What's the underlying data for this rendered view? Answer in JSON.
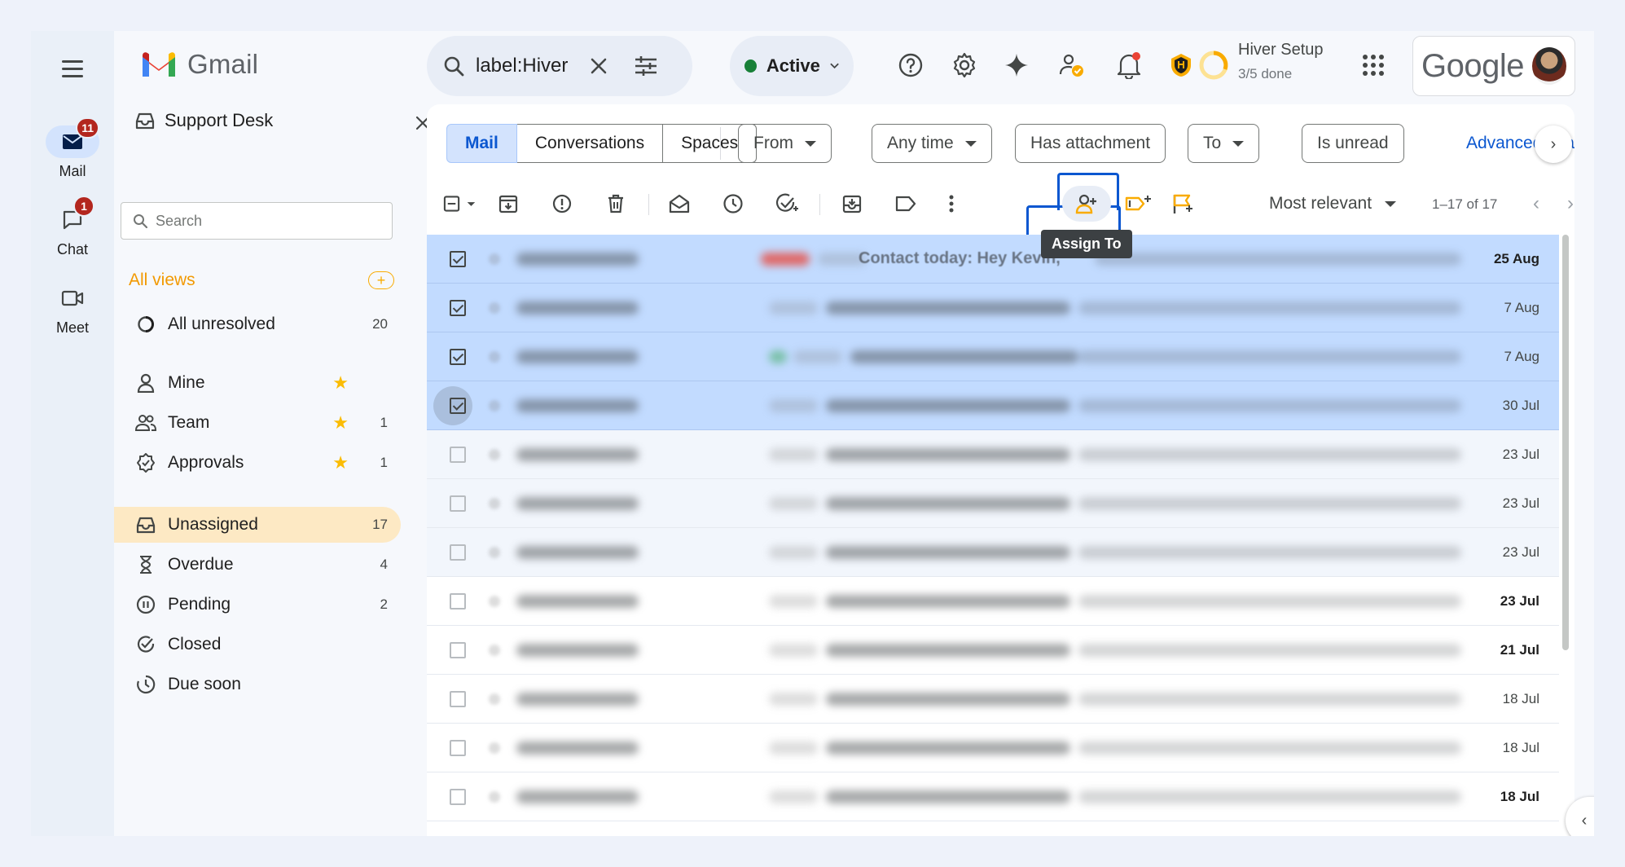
{
  "app": {
    "logo_text": "Gmail"
  },
  "rail": {
    "items": [
      {
        "label": "Mail",
        "badge": "11",
        "icon": "mail-icon"
      },
      {
        "label": "Chat",
        "badge": "1",
        "icon": "chat-icon"
      },
      {
        "label": "Meet",
        "icon": "video-icon"
      }
    ]
  },
  "search": {
    "query": "label:Hiver"
  },
  "status": {
    "label": "Active",
    "color": "#188038"
  },
  "setup": {
    "title": "Hiver Setup",
    "progress": "3/5 done"
  },
  "account": {
    "brand": "Google"
  },
  "panel": {
    "title": "Support Desk",
    "search_placeholder": "Search",
    "views_heading": "All views",
    "views_add": "+",
    "items": [
      {
        "label": "All unresolved",
        "count": "20",
        "icon": "circle-progress-icon"
      },
      {
        "label": "Mine",
        "starred": true,
        "icon": "person-icon"
      },
      {
        "label": "Team",
        "starred": true,
        "count": "1",
        "icon": "people-icon"
      },
      {
        "label": "Approvals",
        "starred": true,
        "count": "1",
        "icon": "approval-icon"
      },
      {
        "label": "Unassigned",
        "count": "17",
        "active": true,
        "icon": "inbox-icon"
      },
      {
        "label": "Overdue",
        "count": "4",
        "icon": "hourglass-icon"
      },
      {
        "label": "Pending",
        "count": "2",
        "icon": "pause-icon"
      },
      {
        "label": "Closed",
        "icon": "check-circle-icon"
      },
      {
        "label": "Due soon",
        "icon": "clock-icon"
      }
    ]
  },
  "tabs": [
    "Mail",
    "Conversations",
    "Spaces"
  ],
  "filters": {
    "from": "From",
    "any_time": "Any time",
    "has_attachment": "Has attachment",
    "to": "To",
    "is_unread": "Is unread",
    "advanced": "Advanced search"
  },
  "toolbar": {
    "tooltip": "Assign To",
    "sort": "Most relevant",
    "page_info": "1–17 of 17"
  },
  "emails": [
    {
      "date": "25 Aug",
      "selected": true,
      "bold": true,
      "visible_text": "Contact today: Hey Kevin,"
    },
    {
      "date": "7 Aug",
      "selected": true
    },
    {
      "date": "7 Aug",
      "selected": true
    },
    {
      "date": "30 Jul",
      "selected": true
    },
    {
      "date": "23 Jul"
    },
    {
      "date": "23 Jul"
    },
    {
      "date": "23 Jul"
    },
    {
      "date": "23 Jul",
      "bold": true
    },
    {
      "date": "21 Jul",
      "bold": true
    },
    {
      "date": "18 Jul"
    },
    {
      "date": "18 Jul"
    },
    {
      "date": "18 Jul",
      "bold": true
    }
  ]
}
